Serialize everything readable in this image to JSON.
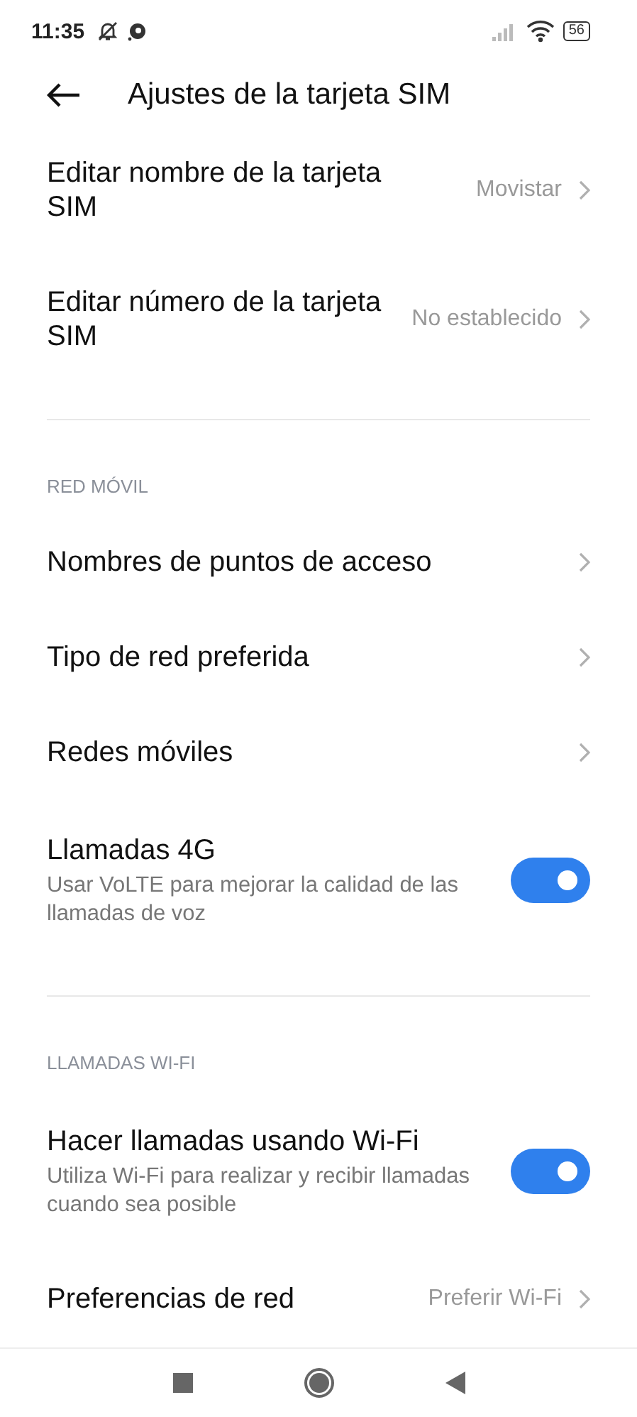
{
  "status_bar": {
    "time": "11:35",
    "battery": "56"
  },
  "header": {
    "title": "Ajustes de la tarjeta SIM"
  },
  "sections": [
    {
      "items": [
        {
          "kind": "link",
          "title": "Editar nombre de la tarjeta SIM",
          "value": "Movistar"
        },
        {
          "kind": "link",
          "title": "Editar número de la tarjeta SIM",
          "value": "No establecido"
        }
      ]
    },
    {
      "header": "RED MÓVIL",
      "items": [
        {
          "kind": "link",
          "title": "Nombres de puntos de acceso"
        },
        {
          "kind": "link",
          "title": "Tipo de red preferida"
        },
        {
          "kind": "link",
          "title": "Redes móviles"
        },
        {
          "kind": "toggle",
          "title": "Llamadas 4G",
          "subtitle": "Usar VoLTE para mejorar la calidad de las llamadas de voz",
          "on": true
        }
      ]
    },
    {
      "header": "LLAMADAS WI-FI",
      "items": [
        {
          "kind": "toggle",
          "title": "Hacer llamadas usando Wi-Fi",
          "subtitle": "Utiliza Wi-Fi para realizar y recibir llamadas cuando sea posible",
          "on": true
        },
        {
          "kind": "link",
          "title": "Preferencias de red",
          "value": "Preferir Wi-Fi"
        }
      ]
    }
  ]
}
